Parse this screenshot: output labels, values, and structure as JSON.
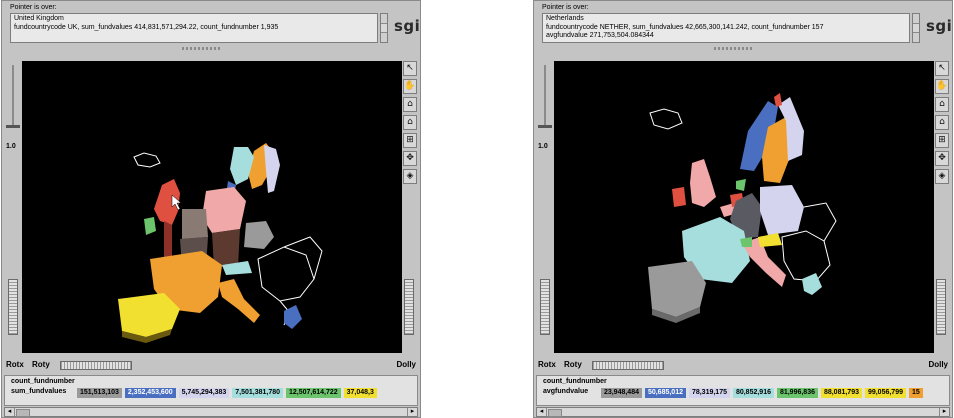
{
  "panels": [
    {
      "pointer_label": "Pointer is over:",
      "info_lines": [
        "United Kingdom",
        "fundcountrycode UK, sum_fundvalues 414,831,571,294.22, count_fundnumber 1,935"
      ],
      "logo": "sgi",
      "slider_value": "1.0",
      "rotx_label": "Rotx",
      "roty_label": "Roty",
      "dolly_label": "Dolly",
      "legend_title": "count_fundnumber",
      "legend_name": "sum_fundvalues",
      "legend_items": [
        {
          "text": "151,513,103",
          "color": "#9a9a9a",
          "fg": "#000000"
        },
        {
          "text": "2,352,453,600",
          "color": "#4a6fc0",
          "fg": "#ffffff"
        },
        {
          "text": "5,745,294,383",
          "color": "#d4d4ee",
          "fg": "#000000"
        },
        {
          "text": "7,501,381,780",
          "color": "#a6dede",
          "fg": "#000000"
        },
        {
          "text": "12,507,614,722",
          "color": "#6cc46c",
          "fg": "#000000"
        },
        {
          "text": "37,048,3",
          "color": "#f2e030",
          "fg": "#000000"
        }
      ]
    },
    {
      "pointer_label": "Pointer is over:",
      "info_lines": [
        "Netherlands",
        "fundcountrycode NETHER, sum_fundvalues 42,665,300,141.242, count_fundnumber 157",
        "avgfundvalue 271,753,504.084344"
      ],
      "logo": "sgi",
      "slider_value": "1.0",
      "rotx_label": "Rotx",
      "roty_label": "Roty",
      "dolly_label": "Dolly",
      "legend_title": "count_fundnumber",
      "legend_name": "avgfundvalue",
      "legend_items": [
        {
          "text": "23,948,484",
          "color": "#9a9a9a",
          "fg": "#000000"
        },
        {
          "text": "50,685,012",
          "color": "#4a6fc0",
          "fg": "#ffffff"
        },
        {
          "text": "78,319,175",
          "color": "#d4d4ee",
          "fg": "#000000"
        },
        {
          "text": "80,852,916",
          "color": "#a6dede",
          "fg": "#000000"
        },
        {
          "text": "81,996,836",
          "color": "#6cc46c",
          "fg": "#000000"
        },
        {
          "text": "88,081,793",
          "color": "#f2e030",
          "fg": "#000000"
        },
        {
          "text": "99,056,799",
          "color": "#f2e030",
          "fg": "#000000"
        },
        {
          "text": "15",
          "color": "#f0a030",
          "fg": "#000000"
        }
      ]
    }
  ],
  "tool_icons": [
    "select-arrow-icon",
    "hand-icon",
    "home-icon",
    "set-home-icon",
    "view-all-icon",
    "seek-icon",
    "projection-icon"
  ],
  "colors": {
    "panel_bg": "#c4c4c4",
    "viewer_bg": "#000000",
    "gray": "#9a9a9a",
    "blue": "#4a6fc0",
    "lavender": "#d4d4ee",
    "cyan": "#a6dede",
    "green": "#6cc46c",
    "yellow": "#f2e030",
    "orange": "#f0a030",
    "pink": "#f0a8a8",
    "red": "#e05040"
  }
}
